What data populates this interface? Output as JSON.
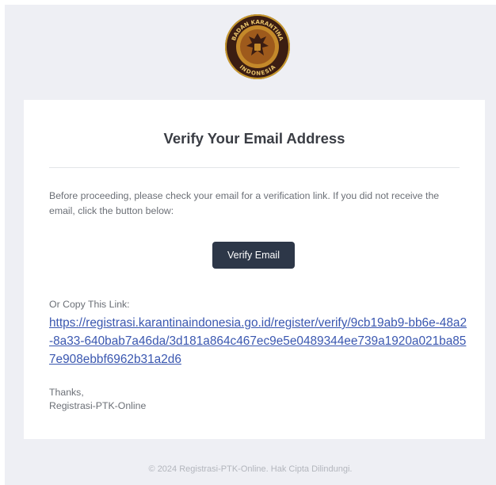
{
  "header": {
    "logo_icon": "badan-karantina-indonesia-emblem",
    "logo_text_top": "BADAN KARANTINA",
    "logo_text_bottom": "INDONESIA"
  },
  "card": {
    "title": "Verify Your Email Address",
    "intro": "Before proceeding, please check your email for a verification link. If you did not receive the email, click the button below:",
    "button_label": "Verify Email",
    "copy_label": "Or Copy This Link:",
    "link": "https://registrasi.karantinaindonesia.go.id/register/verify/9cb19ab9-bb6e-48a2-8a33-640bab7a46da/3d181a864c467ec9e5e0489344ee739a1920a021ba857e908ebbf6962b31a2d6",
    "thanks": "Thanks,",
    "signature": "Registrasi-PTK-Online"
  },
  "footer": {
    "text": "© 2024 Registrasi-PTK-Online. Hak Cipta Dilindungi."
  },
  "colors": {
    "background": "#eeeff4",
    "button": "#2d3748",
    "link": "#3a57b0"
  }
}
